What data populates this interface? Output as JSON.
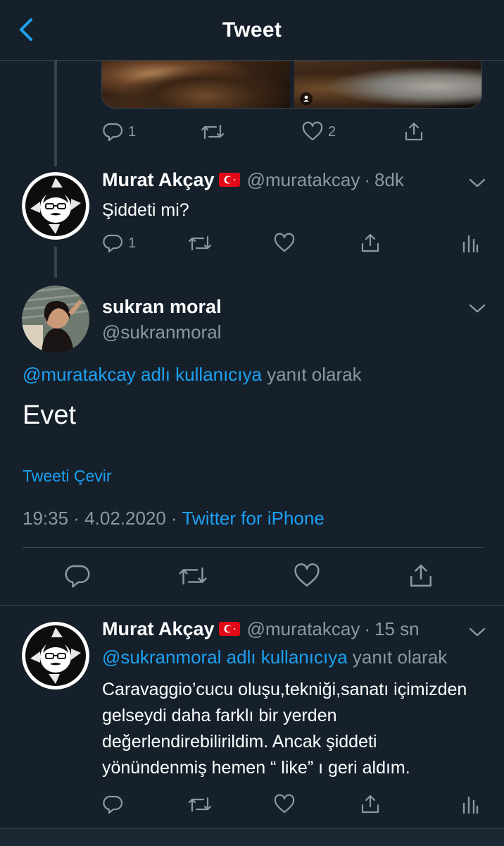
{
  "header": {
    "title": "Tweet"
  },
  "prev_tweet": {
    "reply_count": "1",
    "like_count": "2"
  },
  "tweet1": {
    "name": "Murat Akçay",
    "handle": "@muratakcay",
    "sep": "·",
    "time": "8dk",
    "text": "Şiddeti mi?",
    "reply_count": "1"
  },
  "main": {
    "name": "sukran moral",
    "handle": "@sukranmoral",
    "reply_to_handle": "@muratakcay adlı kullanıcıya",
    "reply_to_suffix": "yanıt olarak",
    "text": "Evet",
    "translate": "Tweeti Çevir",
    "time": "19:35 · 4.02.2020 ·",
    "source": "Twitter for iPhone"
  },
  "tweet3": {
    "name": "Murat Akçay",
    "handle": "@muratakcay",
    "sep": "·",
    "time": "15 sn",
    "reply_to_handle": "@sukranmoral adlı kullanıcıya",
    "reply_to_suffix": "yanıt olarak",
    "text": "Caravaggio’cucu oluşu,tekniği,sanatı içimizden gelseydi daha farklı bir yerden değerlendirebilirildim. Ancak şiddeti yönündenmiş hemen “ like” ı geri aldım."
  },
  "colors": {
    "background": "#15202b",
    "accent": "#1da1f2",
    "muted": "#8899a6",
    "divider": "#38444d",
    "flag_red": "#e30a17"
  },
  "icons": [
    "chevron-left-icon",
    "reply-icon",
    "retweet-icon",
    "like-icon",
    "share-icon",
    "analytics-icon",
    "chevron-down-icon",
    "person-icon",
    "flag-tr-icon"
  ]
}
